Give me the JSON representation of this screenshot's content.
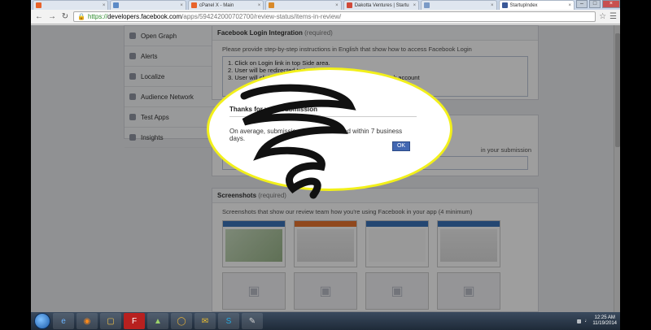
{
  "browser": {
    "tabs": [
      {
        "label": "",
        "favicon": "joomla-icon",
        "color": "#e8632b",
        "active": false
      },
      {
        "label": "",
        "favicon": "page-icon",
        "color": "#5b8ac6",
        "active": false
      },
      {
        "label": "cPanel X - Main",
        "favicon": "cpanel-icon",
        "color": "#e8632b",
        "active": false
      },
      {
        "label": "",
        "favicon": "page-icon",
        "color": "#d88a2a",
        "active": false
      },
      {
        "label": "Dakotta Ventures | Startu",
        "favicon": "page-icon",
        "color": "#d04a3a",
        "active": false
      },
      {
        "label": "",
        "favicon": "page-icon",
        "color": "#7a9ac6",
        "active": false
      },
      {
        "label": "StartupIndex",
        "favicon": "facebook-icon",
        "color": "#3b5998",
        "active": true
      }
    ],
    "address": {
      "scheme": "https://",
      "host": "developers.facebook.com",
      "path": "/apps/594242000702700/review-status/items-in-review/"
    }
  },
  "sidebar": {
    "items": [
      {
        "label": "Open Graph"
      },
      {
        "label": "Alerts"
      },
      {
        "label": "Localize"
      },
      {
        "label": "Audience Network"
      },
      {
        "label": "Test Apps"
      },
      {
        "label": "Insights"
      }
    ]
  },
  "login_panel": {
    "title": "Facebook Login Integration",
    "required": "(required)",
    "description": "Please provide step-by-step instructions in English that show how to access Facebook Login",
    "steps": [
      "1. Click on Login link in top Side area.",
      "2. User will be redirected to Login page.",
      "3. User will click on the blue login button to authorize facebook account"
    ]
  },
  "second_panel": {
    "text": "in your submission",
    "input_text": "users."
  },
  "screenshots_panel": {
    "title": "Screenshots",
    "required": "(required)",
    "description": "Screenshots that show our review team how you're using Facebook in your app (4 minimum)"
  },
  "dialog": {
    "title": "Thanks for your Submission",
    "body": "On average, submissions will be reviewed within 7 business days.",
    "ok_label": "OK"
  },
  "taskbar": {
    "apps": [
      "ie-icon",
      "firefox-icon",
      "folder-icon",
      "filezilla-icon",
      "shield-icon",
      "chrome-icon",
      "outlook-icon",
      "skype-icon",
      "paint-icon"
    ],
    "time": "12:25 AM",
    "date": "11/19/2014"
  },
  "colors": {
    "highlight_ring": "#f2f01a",
    "facebook_blue": "#3b5998"
  }
}
